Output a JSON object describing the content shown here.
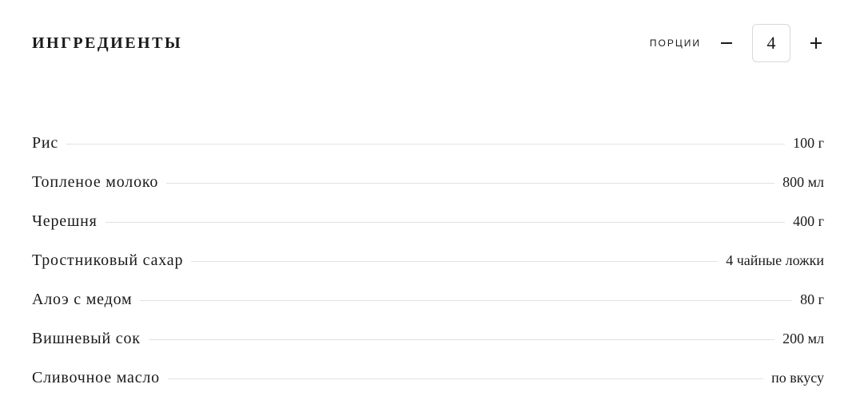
{
  "header": {
    "title": "ИНГРЕДИЕНТЫ",
    "portions_label": "ПОРЦИИ",
    "portions_value": "4"
  },
  "ingredients": [
    {
      "name": "Рис",
      "amount": "100 г"
    },
    {
      "name": "Топленое молоко",
      "amount": "800 мл"
    },
    {
      "name": "Черешня",
      "amount": "400 г"
    },
    {
      "name": "Тростниковый сахар",
      "amount": "4 чайные ложки"
    },
    {
      "name": "Алоэ с медом",
      "amount": "80 г"
    },
    {
      "name": "Вишневый сок",
      "amount": "200 мл"
    },
    {
      "name": "Сливочное масло",
      "amount": "по вкусу"
    }
  ]
}
